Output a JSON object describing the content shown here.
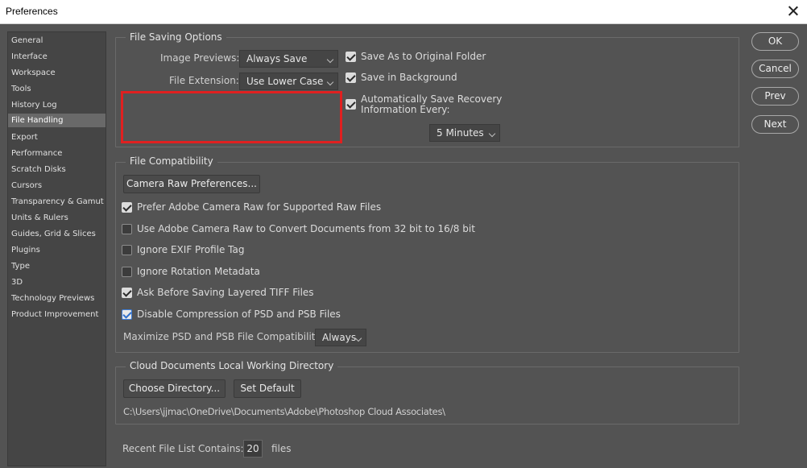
{
  "window": {
    "title": "Preferences"
  },
  "sidebar": {
    "items": [
      {
        "label": "General"
      },
      {
        "label": "Interface"
      },
      {
        "label": "Workspace"
      },
      {
        "label": "Tools"
      },
      {
        "label": "History Log"
      },
      {
        "label": "File Handling",
        "selected": true
      },
      {
        "label": "Export"
      },
      {
        "label": "Performance"
      },
      {
        "label": "Scratch Disks"
      },
      {
        "label": "Cursors"
      },
      {
        "label": "Transparency & Gamut"
      },
      {
        "label": "Units & Rulers"
      },
      {
        "label": "Guides, Grid & Slices"
      },
      {
        "label": "Plugins"
      },
      {
        "label": "Type"
      },
      {
        "label": "3D"
      },
      {
        "label": "Technology Previews"
      },
      {
        "label": "Product Improvement"
      }
    ]
  },
  "file_saving": {
    "legend": "File Saving Options",
    "image_previews_label": "Image Previews:",
    "image_previews_value": "Always Save",
    "file_extension_label": "File Extension:",
    "file_extension_value": "Use Lower Case",
    "save_as_original": {
      "label": "Save As to Original Folder",
      "checked": true
    },
    "save_in_background": {
      "label": "Save in Background",
      "checked": true
    },
    "auto_save": {
      "label_line1": "Automatically Save Recovery",
      "label_line2": "Information Every:",
      "checked": true
    },
    "auto_save_interval": "5 Minutes"
  },
  "file_compat": {
    "legend": "File Compatibility",
    "camera_raw_button": "Camera Raw Preferences...",
    "options": [
      {
        "label": "Prefer Adobe Camera Raw for Supported Raw Files",
        "checked": true
      },
      {
        "label": "Use Adobe Camera Raw to Convert Documents from 32 bit to 16/8 bit",
        "checked": false
      },
      {
        "label": "Ignore EXIF Profile Tag",
        "checked": false
      },
      {
        "label": "Ignore Rotation Metadata",
        "checked": false
      },
      {
        "label": "Ask Before Saving Layered TIFF Files",
        "checked": true
      },
      {
        "label": "Disable Compression of PSD and PSB Files",
        "checked": true
      }
    ],
    "maximize_label": "Maximize PSD and PSB File Compatibility:",
    "maximize_value": "Always"
  },
  "cloud": {
    "legend": "Cloud Documents Local Working Directory",
    "choose_button": "Choose Directory...",
    "default_button": "Set Default",
    "path": "C:\\Users\\jjmac\\OneDrive\\Documents\\Adobe\\Photoshop Cloud Associates\\"
  },
  "recent": {
    "label": "Recent File List Contains:",
    "value": "20",
    "suffix": "files"
  },
  "actions": {
    "ok": "OK",
    "cancel": "Cancel",
    "prev": "Prev",
    "next": "Next"
  },
  "colors": {
    "background": "#535353",
    "sidebar_selected": "#696969",
    "highlight_box": "#e02020"
  }
}
